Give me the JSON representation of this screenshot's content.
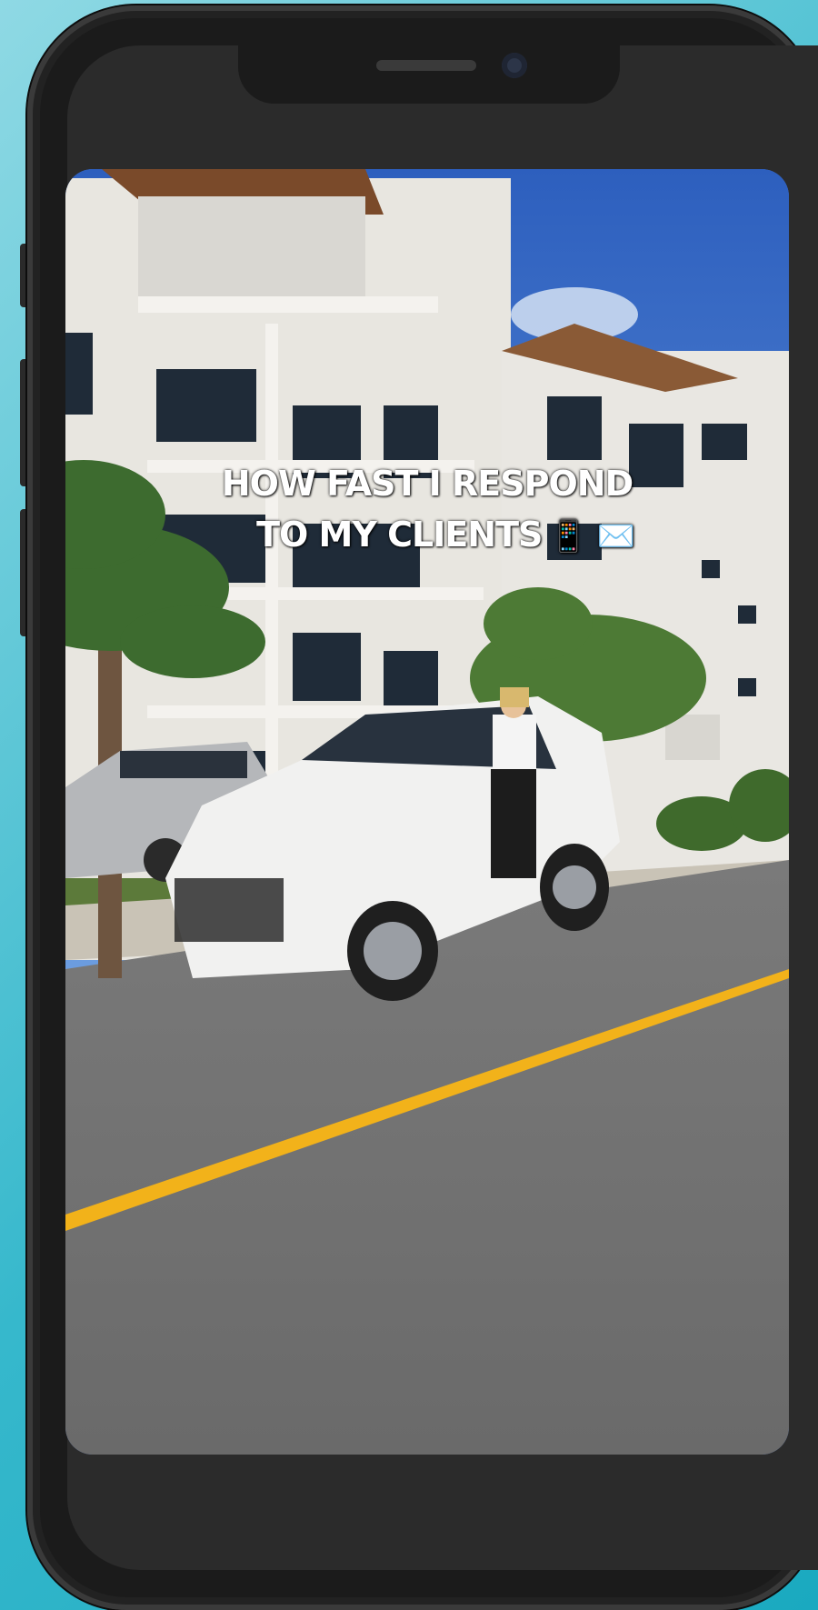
{
  "video": {
    "caption_line1": "HOW FAST I RESPOND",
    "caption_line2": "TO MY CLIENTS",
    "caption_emojis": "📱 ✉️"
  },
  "colors": {
    "background": "#36b8cc",
    "phone_frame": "#1b1b1b",
    "sky": "#3e6ec9",
    "road": "#6d6d6d",
    "road_line": "#f2b21a"
  }
}
